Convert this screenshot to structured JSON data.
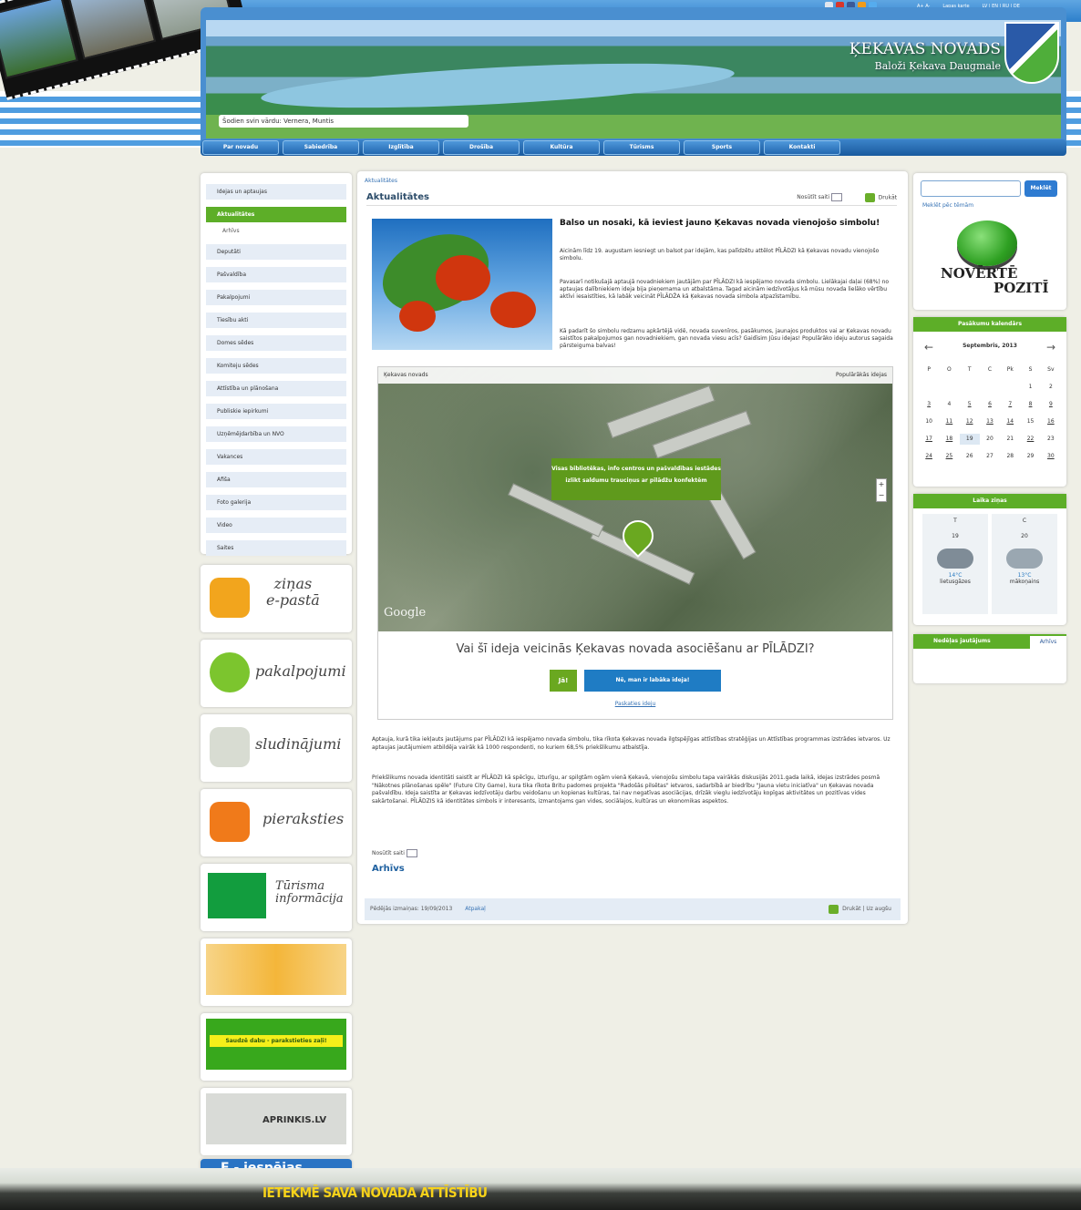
{
  "header": {
    "title": "ĶEKAVAS NOVADS",
    "subtitle": "Baloži  Ķekava  Daugmale",
    "nameday": "Šodien svin vārdu: Vernera, Muntis",
    "toplinks": [
      "A+  A-",
      "Lapas karte",
      "LV | EN | RU | DE"
    ]
  },
  "nav": [
    "Par novadu",
    "Sabiedrība",
    "Izglītība",
    "Drošība",
    "Kultūra",
    "Tūrisms",
    "Sports",
    "Kontakti"
  ],
  "left_menu": [
    {
      "label": "Idejas un aptaujas"
    },
    {
      "label": "Aktualitātes",
      "active": true
    },
    {
      "label": "Arhīvs",
      "sub": true
    },
    {
      "label": "Deputāti"
    },
    {
      "label": "Pašvaldība"
    },
    {
      "label": "Pakalpojumi"
    },
    {
      "label": "Tiesību akti"
    },
    {
      "label": "Domes sēdes"
    },
    {
      "label": "Komiteju sēdes"
    },
    {
      "label": "Attīstība un plānošana"
    },
    {
      "label": "Publiskie iepirkumi"
    },
    {
      "label": "Uzņēmējdarbība un NVO"
    },
    {
      "label": "Vakances"
    },
    {
      "label": "Afiša"
    },
    {
      "label": "Foto galerija"
    },
    {
      "label": "Video"
    },
    {
      "label": "Saites"
    }
  ],
  "banners": {
    "email": "ziņas\ne-pastā",
    "eserv": "pakalpojumi",
    "ads": "sludinājumi",
    "rss": "pieraksties",
    "tourism": "Tūrisma\ninformācija",
    "green": "Saudzē dabu - parakstieties zaļi!",
    "aprinkis": "APRINKIS.LV",
    "eiesp": "E - iespējas"
  },
  "main": {
    "breadcrumb": "Aktualitātes",
    "title": "Aktualitātes",
    "send_label": "Nosūtīt saiti",
    "print_label": "Drukāt",
    "article_title": "Balso un nosaki, kā ieviest jauno Ķekavas novada vienojošo simbolu!",
    "p1": "Aicinām līdz 19. augustam iesniegt un balsot par idejām, kas palīdzētu attēlot PĪLĀDZI kā Ķekavas novadu vienojošo simbolu.",
    "p2": "Pavasarī notikušajā aptaujā novadniekiem jautājām par PĪLĀDZI kā iespējamo novada simbolu. Lielākajai daļai (68%) no aptaujas dalībniekiem ideja bija pieņemama un atbalstāma. Tagad aicinām iedzīvotājus kā mūsu novada lielāko vērtību aktīvi iesaistīties, kā labāk veicināt PĪLĀDŽA kā Ķekavas novada simbola atpazīstamību.",
    "p3": "Kā padarīt šo simbolu redzamu apkārtējā vidē, novada suvenīros, pasākumos, jaunajos produktos vai ar Ķekavas novadu saistītos pakalpojumos gan novadniekiem, gan novada viesu acīs? Gaidīsim Jūsu idejas! Populārāko ideju autorus sagaida pārsteiguma balvas!",
    "widget_brand": "Ķekavas novads",
    "widget_tab": "Populārākās idejas",
    "bubble": "Visas bibliotēkas, info centros un pašvaldības iestādes izlikt saldumu trauciņus ar pīlādžu konfektēm",
    "question": "Vai šī ideja veicinās Ķekavas novada asociēšanu ar PĪLĀDZI?",
    "yes": "Jā!",
    "no": "Nē, man ir labāka ideja!",
    "look": "Paskaties ideju",
    "google": "Google",
    "body1": "Aptauja, kurā tika iekļauts jautājums par PĪLĀDZI kā iespējamo novada simbolu, tika rīkota Ķekavas novada ilgtspējīgas attīstības stratēģijas un Attīstības programmas izstrādes ietvaros. Uz aptaujas jautājumiem atbildēja vairāk kā 1000 respondenti, no kuriem 68,5% priekšlikumu atbalstīja.",
    "body2": "Priekšlikums novada identitāti saistīt ar PĪLĀDZI kā spēcīgu, izturīgu, ar spilgtām ogām vienā Ķekavā, vienojošu simbolu tapa vairākās diskusijās 2011.gada laikā, idejas izstrādes posmā \"Nākotnes plānošanas spēle\" (Future City Game), kura tika rīkota Britu padomes projekta \"Radošās pilsētas\" ietvaros, sadarbībā ar biedrību \"Jauna vietu iniciatīva\" un Ķekavas novada pašvaldību. Ideja saistīta ar Ķekavas iedzīvotāju darbu veidošanu un kopienas kultūras, tai nav negatīvas asociācijas, drīzāk vieglu iedzīvotāju kopīgas aktivitātes un pozitīvas vides sakārtošanai. PĪLĀDZIS kā identitātes simbols ir interesants, izmantojams gan vides, sociālajos, kultūras un ekonomikas aspektos.",
    "send2": "Nosūtīt saiti",
    "archive": "Arhīvs",
    "changed": "Pēdējās izmaiņas: 19/09/2013",
    "back": "Atpakaļ",
    "print_top": "Drukāt | Uz augšu"
  },
  "right": {
    "search_btn": "Meklēt",
    "search_link": "Meklēt pēc tēmām",
    "rate_line1": "NOVĒRTĒ",
    "rate_line2": "POZITĪ",
    "calendar_title": "Pasākumu kalendārs",
    "month": "Septembris, 2013",
    "weekdays": [
      "P",
      "O",
      "T",
      "C",
      "Pk",
      "S",
      "Sv"
    ],
    "days": [
      "",
      "",
      "",
      "",
      "",
      "1",
      "2",
      "3",
      "4",
      "5",
      "6",
      "7",
      "8",
      "9",
      "10",
      "11",
      "12",
      "13",
      "14",
      "15",
      "16",
      "17",
      "18",
      "19",
      "20",
      "21",
      "22",
      "23",
      "24",
      "25",
      "26",
      "27",
      "28",
      "29",
      "30"
    ],
    "underlined": [
      3,
      5,
      6,
      7,
      8,
      9,
      11,
      12,
      13,
      14,
      16,
      17,
      18,
      22,
      24,
      25,
      30
    ],
    "today": 19,
    "weather_title": "Laika ziņas",
    "w1": {
      "day": "T",
      "date": "19",
      "temp": "14°C",
      "desc": "lietusgāzes"
    },
    "w2": {
      "day": "C",
      "date": "20",
      "temp": "13°C",
      "desc": "mākoņains"
    },
    "latest_tab": "Nedēļas jautājums",
    "latest_btn": "Arhīvs"
  },
  "footer": {
    "slogan": "IETEKMĒ SAVA NOVADA ATTĪSTĪBU"
  },
  "colors": {
    "green": "#5dae28",
    "blue": "#2e7bd1",
    "nav": "#1f64a8"
  }
}
